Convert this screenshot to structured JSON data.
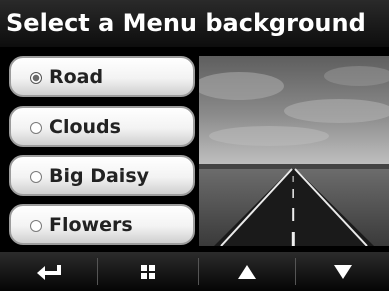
{
  "header": {
    "title": "Select a Menu background"
  },
  "options": [
    {
      "label": "Road",
      "selected": true
    },
    {
      "label": "Clouds",
      "selected": false
    },
    {
      "label": "Big Daisy",
      "selected": false
    },
    {
      "label": "Flowers",
      "selected": false
    }
  ],
  "preview": {
    "image": "road-landscape"
  },
  "toolbar": {
    "buttons": [
      {
        "icon": "back-arrow-icon"
      },
      {
        "icon": "grid-menu-icon"
      },
      {
        "icon": "up-arrow-icon"
      },
      {
        "icon": "down-arrow-icon"
      }
    ]
  }
}
